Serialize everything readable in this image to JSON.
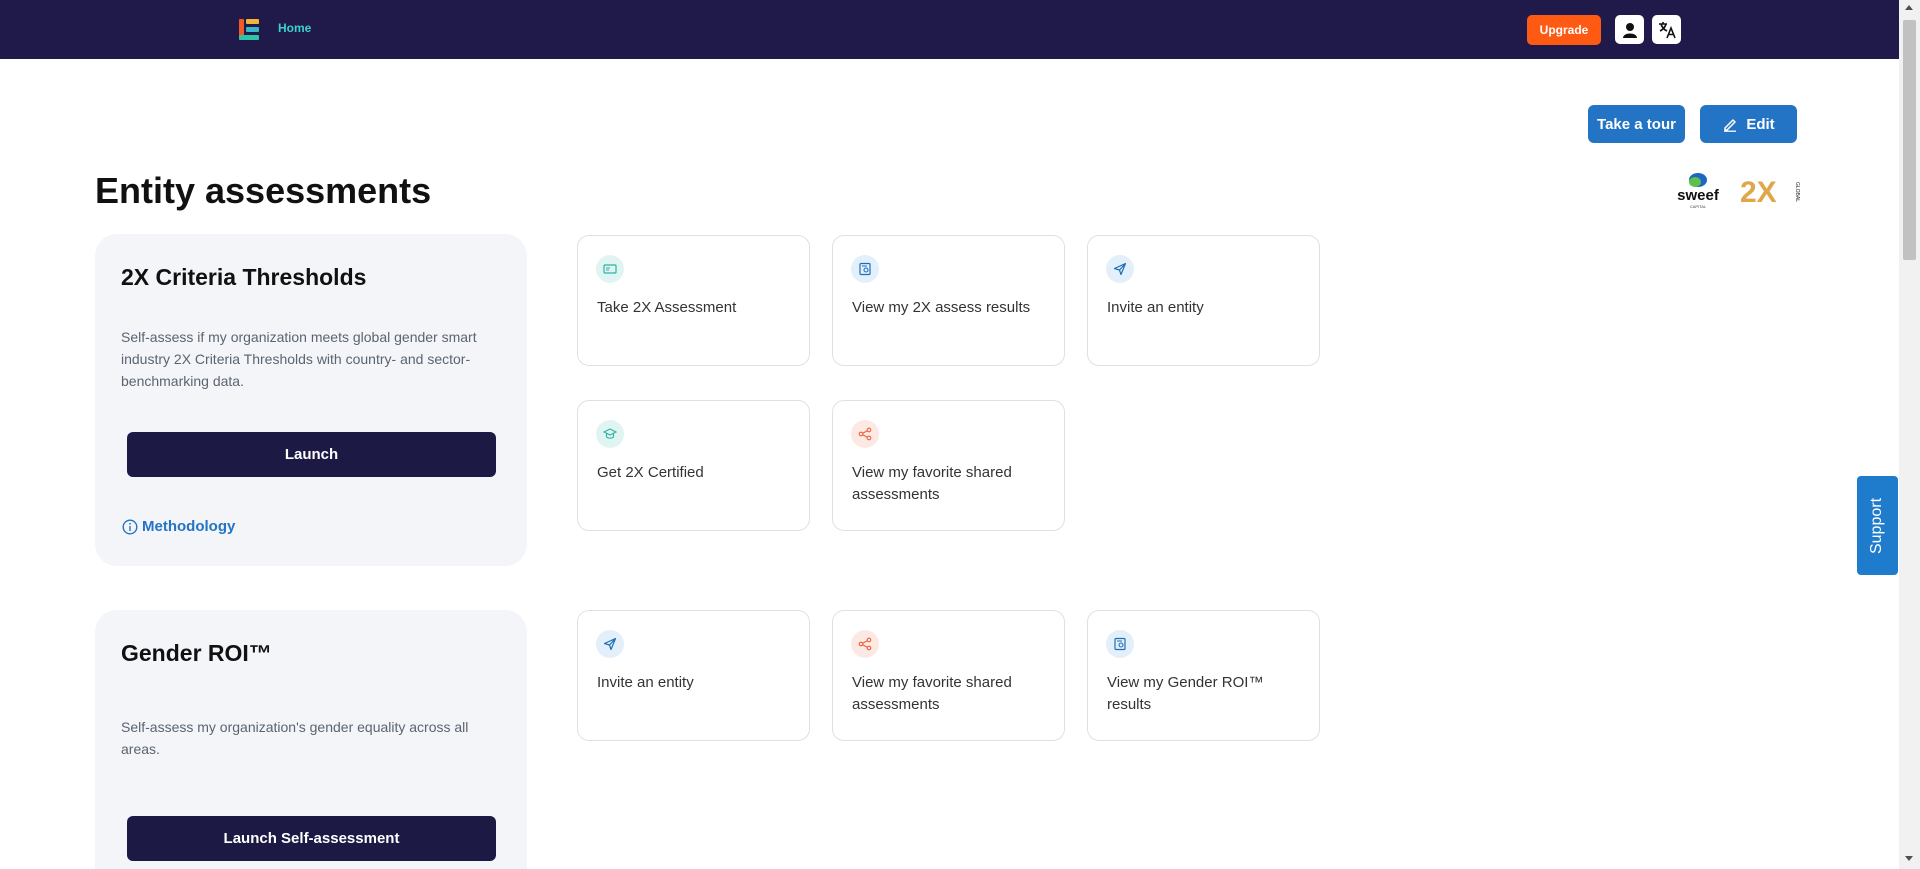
{
  "nav": {
    "home_label": "Home",
    "upgrade_label": "Upgrade"
  },
  "toolbar": {
    "tour_label": "Take a tour",
    "edit_label": "Edit"
  },
  "page": {
    "title": "Entity assessments"
  },
  "sections": [
    {
      "title": "2X Criteria Thresholds",
      "description": "Self-assess if my organization meets global gender smart industry 2X Criteria Thresholds with country- and sector-benchmarking data.",
      "launch_label": "Launch",
      "methodology_label": "Methodology",
      "cards": [
        {
          "label": "Take 2X Assessment",
          "icon": "id-card-icon"
        },
        {
          "label": "View my 2X assess results",
          "icon": "report-icon"
        },
        {
          "label": "Invite an entity",
          "icon": "send-icon"
        },
        {
          "label": "Get 2X Certified",
          "icon": "graduation-cap-icon"
        },
        {
          "label": "View my favorite shared assessments",
          "icon": "share-icon"
        }
      ]
    },
    {
      "title": "Gender ROI™",
      "description": "Self-assess my organization's gender equality across all areas.",
      "launch_label": "Launch Self-assessment",
      "cards": [
        {
          "label": "Invite an entity",
          "icon": "send-icon"
        },
        {
          "label": "View my favorite shared assessments",
          "icon": "share-icon"
        },
        {
          "label": "View my Gender ROI™ results",
          "icon": "report-icon"
        }
      ]
    }
  ],
  "partners": {
    "sweef_text": "sweef",
    "sweef_sub": "CAPITAL",
    "twox_text": "2X",
    "twox_sub": "GLOBAL"
  },
  "support_label": "Support",
  "colors": {
    "nav_bg": "#201a4a",
    "accent": "#2474c5",
    "upgrade": "#ff5a13",
    "launch_bg": "#1c1a45"
  }
}
